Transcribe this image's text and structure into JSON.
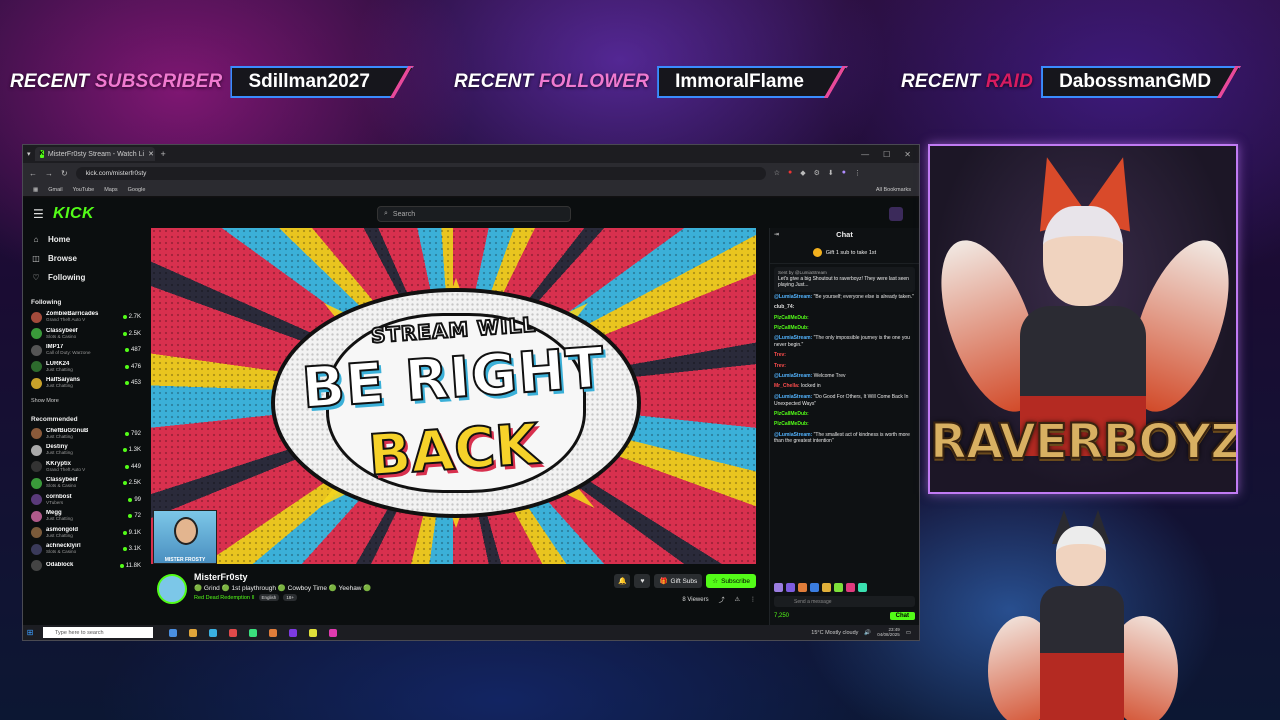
{
  "banners": {
    "subscriber": {
      "label_w": "RECENT",
      "label_c": "SUBSCRIBER",
      "value": "Sdillman2027"
    },
    "follower": {
      "label_w": "RECENT",
      "label_c": "FOLLOWER",
      "value": "ImmoralFlame"
    },
    "raid": {
      "label_w": "RECENT",
      "label_c": "RAID",
      "value": "DabossmanGMD"
    }
  },
  "browser": {
    "tab_title": "MisterFr0sty Stream - Watch Li",
    "url": "kick.com/misterfr0sty",
    "bookmarks": [
      "Gmail",
      "YouTube",
      "Maps",
      "Google"
    ],
    "all_bookmarks": "All Bookmarks"
  },
  "kick": {
    "logo": "KICK",
    "search_placeholder": "Search",
    "nav": [
      {
        "icon": "home-icon",
        "label": "Home"
      },
      {
        "icon": "browse-icon",
        "label": "Browse"
      },
      {
        "icon": "heart-icon",
        "label": "Following"
      }
    ],
    "following_label": "Following",
    "following": [
      {
        "name": "ZombieBarricades",
        "category": "Grand Theft Auto V",
        "viewers": "2.7K",
        "color": "#a34b3b"
      },
      {
        "name": "Classybeef",
        "category": "Slots & Casino",
        "viewers": "2.5K",
        "color": "#3a9a3a"
      },
      {
        "name": "IMP17",
        "category": "Call of Duty: Warzone",
        "viewers": "487",
        "color": "#555"
      },
      {
        "name": "LURK24",
        "category": "Just Chatting",
        "viewers": "476",
        "color": "#2d6b2d"
      },
      {
        "name": "HalfSaiyans",
        "category": "Just Chatting",
        "viewers": "453",
        "color": "#c9a22a"
      }
    ],
    "show_more": "Show More",
    "recommended_label": "Recommended",
    "recommended": [
      {
        "name": "ChefBuGGnuB",
        "category": "Just Chatting",
        "viewers": "792",
        "color": "#8a5a3a"
      },
      {
        "name": "Destiny",
        "category": "Just Chatting",
        "viewers": "1.3K",
        "color": "#aaa"
      },
      {
        "name": "KKryptix",
        "category": "Grand Theft Auto V",
        "viewers": "449",
        "color": "#333"
      },
      {
        "name": "Classybeef",
        "category": "Slots & Casino",
        "viewers": "2.5K",
        "color": "#3a9a3a"
      },
      {
        "name": "cornbost",
        "category": "VTubers",
        "viewers": "99",
        "color": "#5a3a7a"
      },
      {
        "name": "Megg",
        "category": "Just Chatting",
        "viewers": "72",
        "color": "#b05a8a"
      },
      {
        "name": "asmongold",
        "category": "Just Chatting",
        "viewers": "9.1K",
        "color": "#7a5a3a"
      },
      {
        "name": "achnecklyirl",
        "category": "Slots & Casino",
        "viewers": "3.1K",
        "color": "#3a3a5a"
      },
      {
        "name": "Odablock",
        "category": "",
        "viewers": "11.8K",
        "color": "#444"
      }
    ],
    "video": {
      "line1": "STREAM WILL",
      "line2": "BE RIGHT",
      "line3": "BACK",
      "cam_label": "MISTER FROSTY"
    },
    "stream": {
      "streamer": "MisterFr0sty",
      "title": "🟢 Grind 🟢 1st playthrough 🟢 Cowboy Time 🟢 Yeehaw 🟢",
      "category": "Red Dead Redemption II",
      "tags": [
        "English",
        "18+"
      ],
      "gift_label": "Gift Subs",
      "subscribe_label": "Subscribe",
      "viewers": "8 Viewers"
    },
    "chat": {
      "header": "Chat",
      "gift_prompt": "Gift 1 sub to take 1st",
      "pinned_by": "Sent by @LumiaStream",
      "pinned_text": "Let's give a big Shoutout to raverboyz! They were last seen playing Just...",
      "messages": [
        {
          "user": "@LumiaStream:",
          "color": "#53b4ff",
          "text": "\"Be yourself; everyone else is already taken.\""
        },
        {
          "user": "club_74:",
          "color": "#e0e0e0",
          "text": ""
        },
        {
          "user": "PlzCallMeDub:",
          "color": "#53fc18",
          "text": ""
        },
        {
          "user": "PlzCallMeDub:",
          "color": "#53fc18",
          "text": ""
        },
        {
          "user": "@LumiaStream:",
          "color": "#53b4ff",
          "text": "\"The only impossible journey is the one you never begin.\""
        },
        {
          "user": "Trev:",
          "color": "#ff4d4d",
          "text": ""
        },
        {
          "user": "Trev:",
          "color": "#ff4d4d",
          "text": ""
        },
        {
          "user": "@LumiaStream:",
          "color": "#53b4ff",
          "text": "Welcome Trev"
        },
        {
          "user": "Mr_Chella:",
          "color": "#ff4d4d",
          "text": "locked in"
        },
        {
          "user": "@LumiaStream:",
          "color": "#53b4ff",
          "text": "\"Do Good For Others, It Will Come Back In Unexpected Ways\""
        },
        {
          "user": "PlzCallMeDub:",
          "color": "#53fc18",
          "text": ""
        },
        {
          "user": "PlzCallMeDub:",
          "color": "#53fc18",
          "text": ""
        },
        {
          "user": "@LumiaStream:",
          "color": "#53b4ff",
          "text": "\"The smallest act of kindness is worth more than the greatest intention\""
        }
      ],
      "input_placeholder": "Send a message",
      "points": "7,250",
      "send_label": "Chat"
    }
  },
  "taskbar": {
    "search_placeholder": "Type here to search",
    "weather": "15°C  Mostly cloudy",
    "time": "23:49",
    "date": "04/08/2025"
  },
  "webcam": {
    "brand": "RAVERBOYZ"
  }
}
